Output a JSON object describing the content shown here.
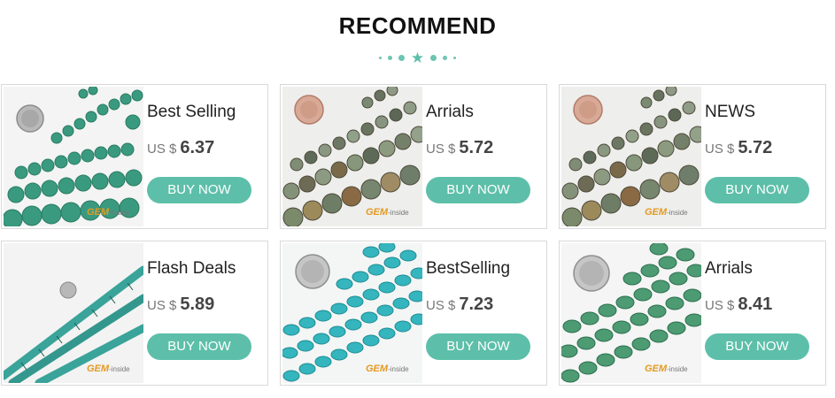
{
  "header": {
    "title": "RECOMMEND",
    "divider_icon": "star-icon"
  },
  "accent_color": "#5dbfa9",
  "products": [
    {
      "name": "Best Selling",
      "currency": "US $",
      "price": "6.37",
      "buy_label": "BUY NOW",
      "logo": "GEM",
      "logo_sub": "-inside"
    },
    {
      "name": "Arrials",
      "currency": "US $",
      "price": "5.72",
      "buy_label": "BUY NOW",
      "logo": "GEM",
      "logo_sub": "-inside"
    },
    {
      "name": "NEWS",
      "currency": "US $",
      "price": "5.72",
      "buy_label": "BUY NOW",
      "logo": "GEM",
      "logo_sub": "-inside"
    },
    {
      "name": "Flash Deals",
      "currency": "US $",
      "price": "5.89",
      "buy_label": "BUY NOW",
      "logo": "GEM",
      "logo_sub": "-inside"
    },
    {
      "name": "BestSelling",
      "currency": "US $",
      "price": "7.23",
      "buy_label": "BUY NOW",
      "logo": "GEM",
      "logo_sub": "-inside"
    },
    {
      "name": "Arrials",
      "currency": "US $",
      "price": "8.41",
      "buy_label": "BUY NOW",
      "logo": "GEM",
      "logo_sub": "-inside"
    }
  ]
}
